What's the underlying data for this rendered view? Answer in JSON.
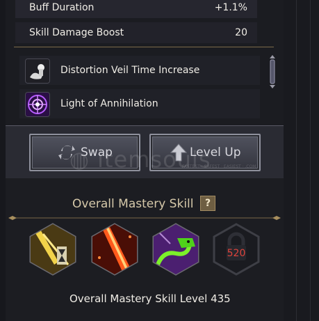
{
  "stats": [
    {
      "label": "Buff Duration",
      "value": "+1.1%"
    },
    {
      "label": "Skill Damage Boost",
      "value": "20"
    }
  ],
  "skills": [
    {
      "label": "Distortion Veil Time Increase",
      "icon": "pestle-icon"
    },
    {
      "label": "Light of Annihilation",
      "icon": "purple-sigil-icon"
    }
  ],
  "buttons": {
    "swap": "Swap",
    "level_up": "Level Up"
  },
  "watermark": {
    "brand": "itemsouls",
    "sub": "FASTEST · SAFEST · EASIEST · .COM"
  },
  "mastery": {
    "title": "Overall Mastery Skill",
    "help": "?",
    "locked_value": "520",
    "level_text": "Overall Mastery Skill Level 435",
    "icons": [
      "hourglass-blade-icon",
      "fire-slash-icon",
      "serpent-icon",
      "lock-icon"
    ]
  },
  "colors": {
    "accent_gold": "#d6c9aa",
    "locked_red": "#e0443c"
  }
}
